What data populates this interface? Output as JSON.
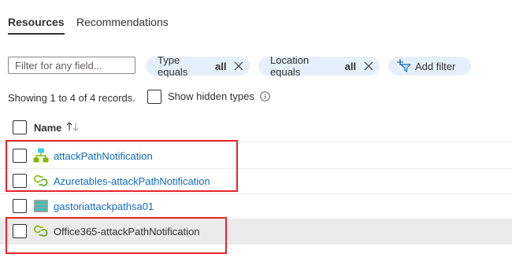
{
  "tabs": [
    {
      "label": "Resources",
      "active": true
    },
    {
      "label": "Recommendations",
      "active": false
    }
  ],
  "filter": {
    "placeholder": "Filter for any field...",
    "value": ""
  },
  "pills": {
    "type": {
      "label": "Type equals",
      "value": "all"
    },
    "location": {
      "label": "Location equals",
      "value": "all"
    },
    "add_filter": {
      "label": "Add filter"
    }
  },
  "records_text": "Showing 1 to 4 of 4 records.",
  "show_hidden": {
    "label": "Show hidden types",
    "checked": false
  },
  "table": {
    "column_name": "Name",
    "rows": [
      {
        "name": "attackPathNotification",
        "icon": "logic-app-icon",
        "selected": false
      },
      {
        "name": "Azuretables-attackPathNotification",
        "icon": "api-connection-icon",
        "selected": false
      },
      {
        "name": "gastoriattackpathsa01",
        "icon": "storage-account-icon",
        "selected": false
      },
      {
        "name": "Office365-attackPathNotification",
        "icon": "api-connection-icon",
        "selected": true
      }
    ]
  },
  "colors": {
    "link": "#0f6cbd",
    "pill_bg": "#e6f0fa",
    "highlight_border": "#e8232a",
    "selected_row": "#ebebeb"
  }
}
